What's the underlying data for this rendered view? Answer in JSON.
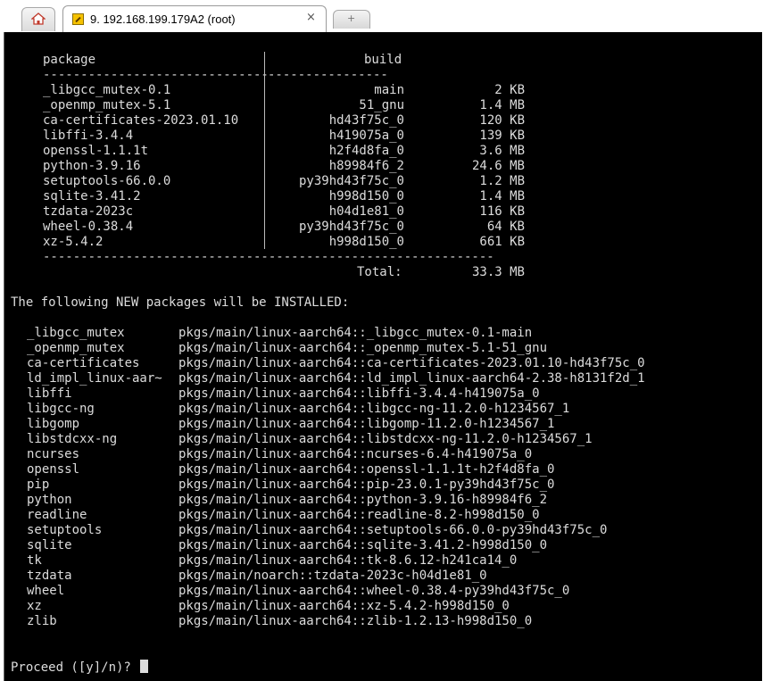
{
  "tabs": {
    "session_title": "9. 192.168.199.179A2 (root)",
    "close_glyph": "×",
    "new_tab_glyph": "+"
  },
  "terminal": {
    "header_package": "package",
    "header_build": "build",
    "dashes_left": "------------------------------",
    "dashes_right": "----------------",
    "summary_rows": [
      {
        "name": "_libgcc_mutex-0.1",
        "build": "main",
        "size": "2 KB"
      },
      {
        "name": "_openmp_mutex-5.1",
        "build": "51_gnu",
        "size": "1.4 MB"
      },
      {
        "name": "ca-certificates-2023.01.10",
        "build": "hd43f75c_0",
        "size": "120 KB"
      },
      {
        "name": "libffi-3.4.4",
        "build": "h419075a_0",
        "size": "139 KB"
      },
      {
        "name": "openssl-1.1.1t",
        "build": "h2f4d8fa_0",
        "size": "3.6 MB"
      },
      {
        "name": "python-3.9.16",
        "build": "h89984f6_2",
        "size": "24.6 MB"
      },
      {
        "name": "setuptools-66.0.0",
        "build": "py39hd43f75c_0",
        "size": "1.2 MB"
      },
      {
        "name": "sqlite-3.41.2",
        "build": "h998d150_0",
        "size": "1.4 MB"
      },
      {
        "name": "tzdata-2023c",
        "build": "h04d1e81_0",
        "size": "116 KB"
      },
      {
        "name": "wheel-0.38.4",
        "build": "py39hd43f75c_0",
        "size": "64 KB"
      },
      {
        "name": "xz-5.4.2",
        "build": "h998d150_0",
        "size": "661 KB"
      }
    ],
    "dashes_bottom": "------------------------------------------------------------",
    "total_label": "Total:",
    "total_value": "33.3 MB",
    "install_heading": "The following NEW packages will be INSTALLED:",
    "install_rows": [
      {
        "name": "_libgcc_mutex",
        "spec": "pkgs/main/linux-aarch64::_libgcc_mutex-0.1-main"
      },
      {
        "name": "_openmp_mutex",
        "spec": "pkgs/main/linux-aarch64::_openmp_mutex-5.1-51_gnu"
      },
      {
        "name": "ca-certificates",
        "spec": "pkgs/main/linux-aarch64::ca-certificates-2023.01.10-hd43f75c_0"
      },
      {
        "name": "ld_impl_linux-aar~",
        "spec": "pkgs/main/linux-aarch64::ld_impl_linux-aarch64-2.38-h8131f2d_1"
      },
      {
        "name": "libffi",
        "spec": "pkgs/main/linux-aarch64::libffi-3.4.4-h419075a_0"
      },
      {
        "name": "libgcc-ng",
        "spec": "pkgs/main/linux-aarch64::libgcc-ng-11.2.0-h1234567_1"
      },
      {
        "name": "libgomp",
        "spec": "pkgs/main/linux-aarch64::libgomp-11.2.0-h1234567_1"
      },
      {
        "name": "libstdcxx-ng",
        "spec": "pkgs/main/linux-aarch64::libstdcxx-ng-11.2.0-h1234567_1"
      },
      {
        "name": "ncurses",
        "spec": "pkgs/main/linux-aarch64::ncurses-6.4-h419075a_0"
      },
      {
        "name": "openssl",
        "spec": "pkgs/main/linux-aarch64::openssl-1.1.1t-h2f4d8fa_0"
      },
      {
        "name": "pip",
        "spec": "pkgs/main/linux-aarch64::pip-23.0.1-py39hd43f75c_0"
      },
      {
        "name": "python",
        "spec": "pkgs/main/linux-aarch64::python-3.9.16-h89984f6_2"
      },
      {
        "name": "readline",
        "spec": "pkgs/main/linux-aarch64::readline-8.2-h998d150_0"
      },
      {
        "name": "setuptools",
        "spec": "pkgs/main/linux-aarch64::setuptools-66.0.0-py39hd43f75c_0"
      },
      {
        "name": "sqlite",
        "spec": "pkgs/main/linux-aarch64::sqlite-3.41.2-h998d150_0"
      },
      {
        "name": "tk",
        "spec": "pkgs/main/linux-aarch64::tk-8.6.12-h241ca14_0"
      },
      {
        "name": "tzdata",
        "spec": "pkgs/main/noarch::tzdata-2023c-h04d1e81_0"
      },
      {
        "name": "wheel",
        "spec": "pkgs/main/linux-aarch64::wheel-0.38.4-py39hd43f75c_0"
      },
      {
        "name": "xz",
        "spec": "pkgs/main/linux-aarch64::xz-5.4.2-h998d150_0"
      },
      {
        "name": "zlib",
        "spec": "pkgs/main/linux-aarch64::zlib-1.2.13-h998d150_0"
      }
    ],
    "prompt": "Proceed ([y]/n)?"
  },
  "colors": {
    "terminal_bg": "#000000",
    "terminal_fg": "#dcdcdc",
    "tab_icon": "#f5c200"
  }
}
